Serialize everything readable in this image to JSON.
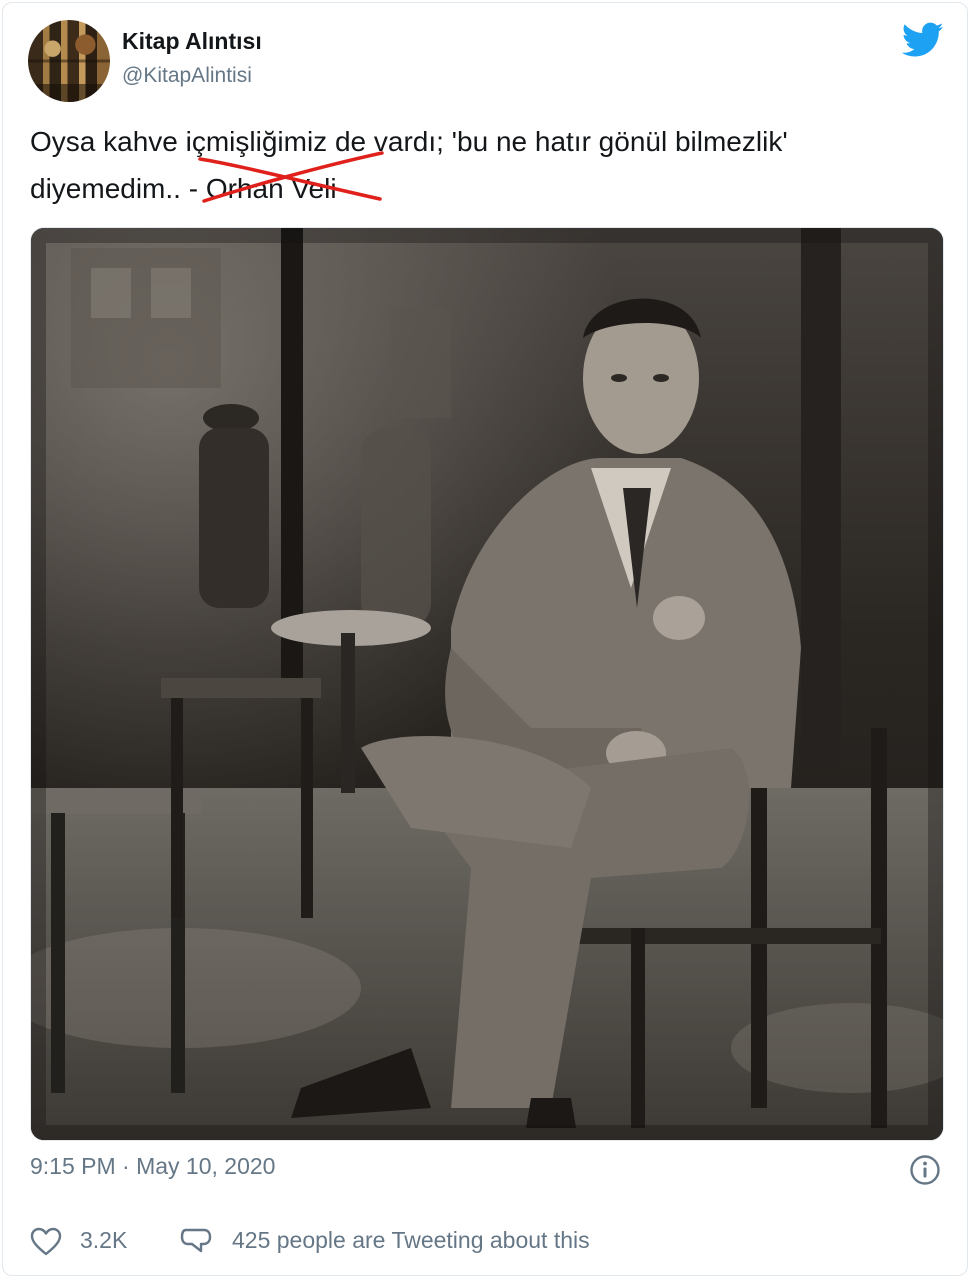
{
  "author": {
    "display_name": "Kitap Alıntısı",
    "handle": "@KitapAlintisi",
    "avatar_icon": "book-shelf-avatar"
  },
  "brand": {
    "icon": "twitter-bird-icon",
    "color": "#1da1f2"
  },
  "tweet": {
    "text_line1": "Oysa kahve içmişliğimiz de vardı; 'bu ne hatır gönül bilmezlik'",
    "text_line2_prefix": "diyemedim.. - ",
    "crossed_out_author": "Orhan Veli",
    "strike_color": "#e0201b",
    "photo_description_icon": "vintage-cafe-photo"
  },
  "meta": {
    "timestamp": "9:15 PM · May 10, 2020",
    "info_icon": "info-circle-icon"
  },
  "engagement": {
    "likes": "3.2K",
    "tweeting_text": "425 people are Tweeting about this"
  }
}
